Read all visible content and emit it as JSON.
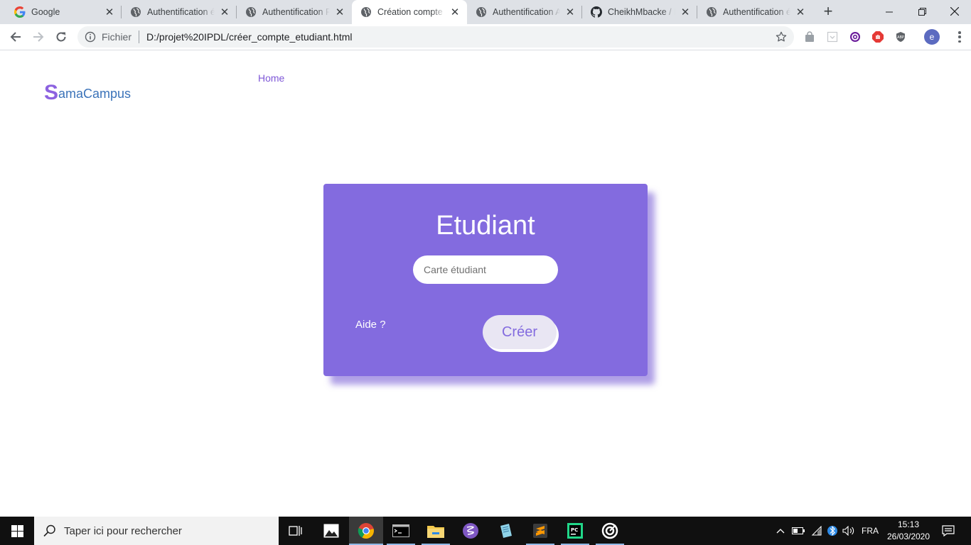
{
  "browser": {
    "tabs": [
      {
        "title": "Google",
        "icon": "google-icon",
        "active": false
      },
      {
        "title": "Authentification étudiant",
        "icon": "globe-icon",
        "active": false
      },
      {
        "title": "Authentification Personnel",
        "icon": "globe-icon",
        "active": false
      },
      {
        "title": "Création compte étudiant",
        "icon": "globe-icon",
        "active": true
      },
      {
        "title": "Authentification Admin",
        "icon": "globe-icon",
        "active": false
      },
      {
        "title": "CheikhMbacke / Logiciel",
        "icon": "github-icon",
        "active": false
      },
      {
        "title": "Authentification étudiant",
        "icon": "globe-icon",
        "active": false
      }
    ],
    "address": {
      "scheme_label": "Fichier",
      "url": "D:/projet%20IPDL/créer_compte_etudiant.html"
    },
    "profile_initial": "e"
  },
  "page": {
    "brand_first_letter": "S",
    "brand_rest": "amaCampus",
    "nav_home": "Home",
    "card": {
      "title": "Etudiant",
      "input_placeholder": "Carte étudiant",
      "input_value": "",
      "help_link": "Aide ?",
      "submit_label": "Créer"
    }
  },
  "taskbar": {
    "search_placeholder": "Taper ici pour rechercher",
    "language": "FRA",
    "time": "15:13",
    "date": "26/03/2020"
  },
  "colors": {
    "accent": "#836bdf",
    "brand_letter": "#8c62e0",
    "brand_text": "#3b73b9"
  }
}
